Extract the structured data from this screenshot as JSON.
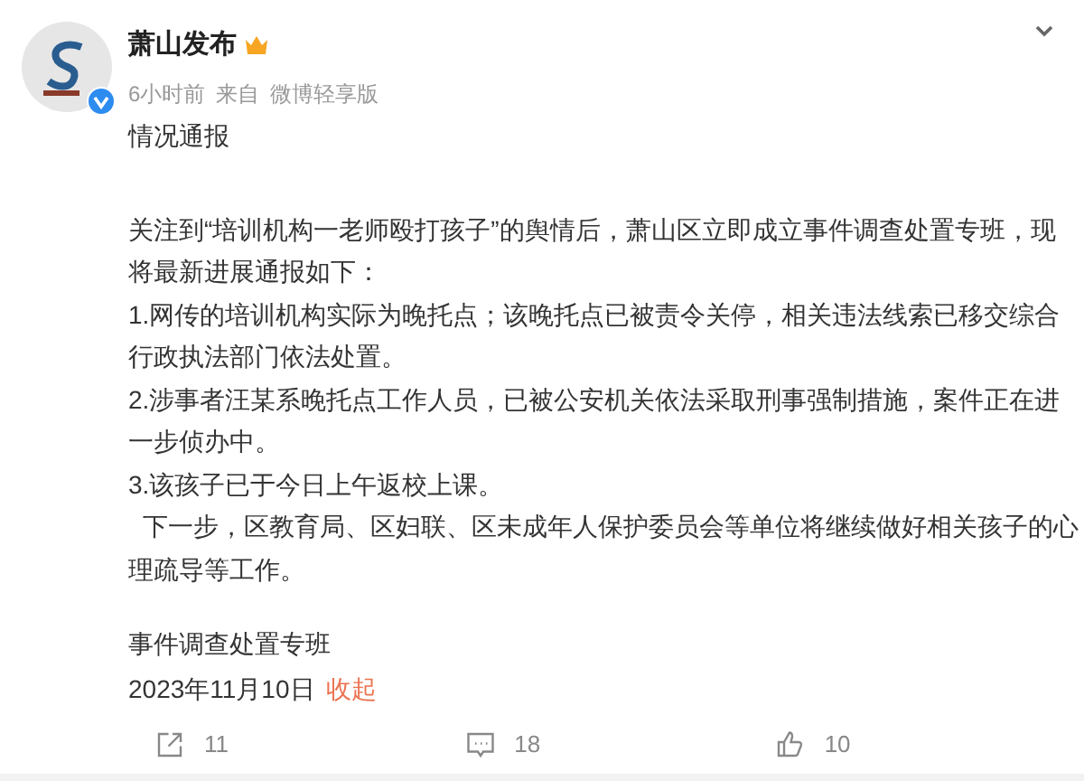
{
  "author": {
    "name": "萧山发布",
    "time": "6小时前",
    "source_prefix": "来自",
    "source": "微博轻享版"
  },
  "post": {
    "title": "情况通报",
    "paragraphs": [
      "关注到“培训机构一老师殴打孩子”的舆情后，萧山区立即成立事件调查处置专班，现将最新进展通报如下：",
      "1.网传的培训机构实际为晚托点；该晚托点已被责令关停，相关违法线索已移交综合行政执法部门依法处置。",
      "2.涉事者汪某系晚托点工作人员，已被公安机关依法采取刑事强制措施，案件正在进一步侦办中。",
      "3.该孩子已于今日上午返校上课。",
      "  下一步，区教育局、区妇联、区未成年人保护委员会等单位将继续做好相关孩子的心理疏导等工作。"
    ],
    "signature": "事件调查处置专班",
    "date": "2023年11月10日",
    "collapse": "收起"
  },
  "actions": [
    {
      "kind": "repost",
      "count": "11"
    },
    {
      "kind": "comment",
      "count": "18"
    },
    {
      "kind": "like",
      "count": "10"
    }
  ]
}
